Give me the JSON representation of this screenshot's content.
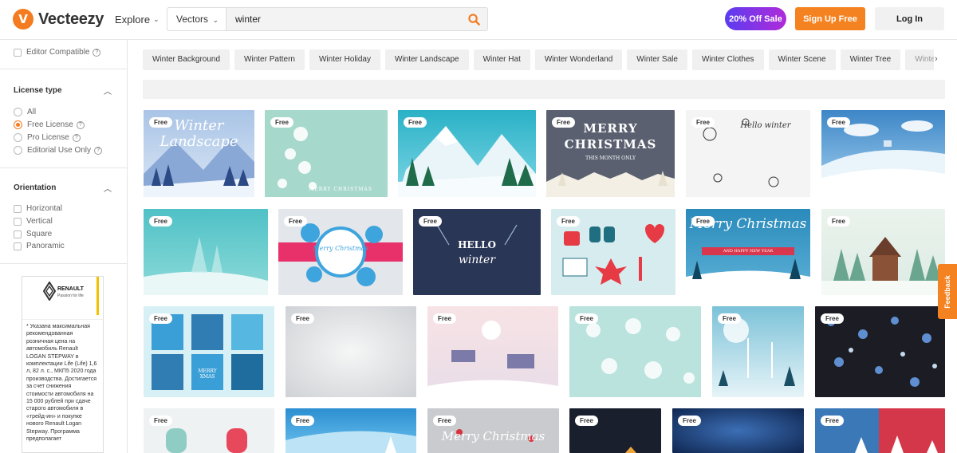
{
  "header": {
    "logo_text": "Vecteezy",
    "explore_label": "Explore",
    "search_type": "Vectors",
    "search_value": "winter",
    "sale_label": "20% Off Sale",
    "signup_label": "Sign Up Free",
    "login_label": "Log In"
  },
  "sidebar": {
    "editor_compatible": "Editor Compatible",
    "license": {
      "title": "License type",
      "options": [
        "All",
        "Free License",
        "Pro License",
        "Editorial Use Only"
      ],
      "selected": "Free License"
    },
    "orientation": {
      "title": "Orientation",
      "options": [
        "Horizontal",
        "Vertical",
        "Square",
        "Panoramic"
      ]
    },
    "ad": {
      "brand": "RENAULT",
      "tagline": "Passion for life",
      "text": "* Указана максимальная рекомендованная розничная цена на автомобиль Renault LOGAN STEPWAY в комплектации Life (Life) 1,6 л, 82 л. с., МКП5 2020 года производства. Достигается за счет снижения стоимости автомобиля на 15 000 рублей при сдаче старого автомобиля в «трейд-ин» и покупке нового Renault Logan Stepway. Программа предполагает"
    }
  },
  "chips": [
    "Winter Background",
    "Winter Pattern",
    "Winter Holiday",
    "Winter Landscape",
    "Winter Hat",
    "Winter Wonderland",
    "Winter Sale",
    "Winter Clothes",
    "Winter Scene",
    "Winter Tree",
    "Winter Borde"
  ],
  "badge_label": "Free",
  "tile_texts": {
    "winter_landscape": "Winter Landscape",
    "merry_christmas_small": "MERRY CHRISTMAS",
    "merry": "MERRY",
    "christmas": "CHRISTMAS",
    "this_month_only": "THIS MONTH ONLY",
    "hello_winter": "Hello winter",
    "hello": "HELLO",
    "winter": "winter",
    "merry_christmas_script": "Merry Christmas",
    "happy_new_year": "AND HAPPY NEW YEAR",
    "merry_xmas": "MERRY XMAS"
  },
  "feedback_label": "Feedback",
  "colors": {
    "accent": "#f47b20",
    "sale_gradient_start": "#5b3cf0",
    "sale_gradient_end": "#b02bd9"
  }
}
